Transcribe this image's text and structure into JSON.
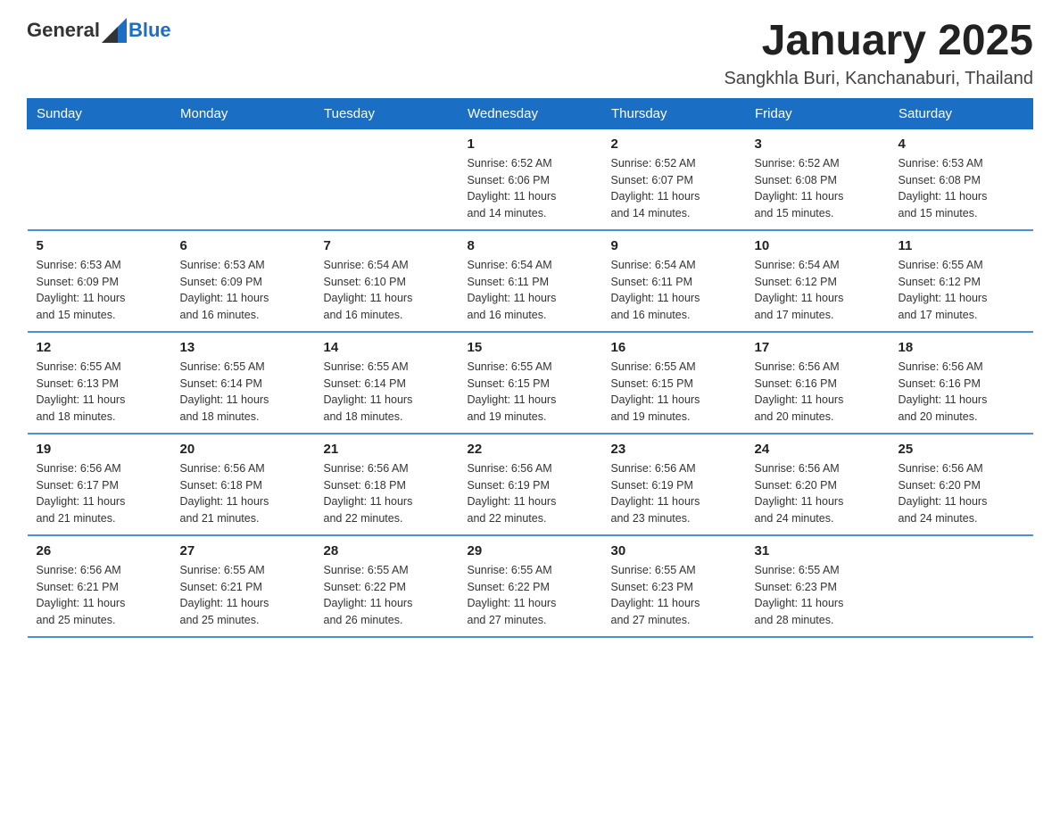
{
  "header": {
    "logo_general": "General",
    "logo_blue": "Blue",
    "title": "January 2025",
    "subtitle": "Sangkhla Buri, Kanchanaburi, Thailand"
  },
  "days_of_week": [
    "Sunday",
    "Monday",
    "Tuesday",
    "Wednesday",
    "Thursday",
    "Friday",
    "Saturday"
  ],
  "weeks": [
    [
      {
        "day": "",
        "info": ""
      },
      {
        "day": "",
        "info": ""
      },
      {
        "day": "",
        "info": ""
      },
      {
        "day": "1",
        "info": "Sunrise: 6:52 AM\nSunset: 6:06 PM\nDaylight: 11 hours\nand 14 minutes."
      },
      {
        "day": "2",
        "info": "Sunrise: 6:52 AM\nSunset: 6:07 PM\nDaylight: 11 hours\nand 14 minutes."
      },
      {
        "day": "3",
        "info": "Sunrise: 6:52 AM\nSunset: 6:08 PM\nDaylight: 11 hours\nand 15 minutes."
      },
      {
        "day": "4",
        "info": "Sunrise: 6:53 AM\nSunset: 6:08 PM\nDaylight: 11 hours\nand 15 minutes."
      }
    ],
    [
      {
        "day": "5",
        "info": "Sunrise: 6:53 AM\nSunset: 6:09 PM\nDaylight: 11 hours\nand 15 minutes."
      },
      {
        "day": "6",
        "info": "Sunrise: 6:53 AM\nSunset: 6:09 PM\nDaylight: 11 hours\nand 16 minutes."
      },
      {
        "day": "7",
        "info": "Sunrise: 6:54 AM\nSunset: 6:10 PM\nDaylight: 11 hours\nand 16 minutes."
      },
      {
        "day": "8",
        "info": "Sunrise: 6:54 AM\nSunset: 6:11 PM\nDaylight: 11 hours\nand 16 minutes."
      },
      {
        "day": "9",
        "info": "Sunrise: 6:54 AM\nSunset: 6:11 PM\nDaylight: 11 hours\nand 16 minutes."
      },
      {
        "day": "10",
        "info": "Sunrise: 6:54 AM\nSunset: 6:12 PM\nDaylight: 11 hours\nand 17 minutes."
      },
      {
        "day": "11",
        "info": "Sunrise: 6:55 AM\nSunset: 6:12 PM\nDaylight: 11 hours\nand 17 minutes."
      }
    ],
    [
      {
        "day": "12",
        "info": "Sunrise: 6:55 AM\nSunset: 6:13 PM\nDaylight: 11 hours\nand 18 minutes."
      },
      {
        "day": "13",
        "info": "Sunrise: 6:55 AM\nSunset: 6:14 PM\nDaylight: 11 hours\nand 18 minutes."
      },
      {
        "day": "14",
        "info": "Sunrise: 6:55 AM\nSunset: 6:14 PM\nDaylight: 11 hours\nand 18 minutes."
      },
      {
        "day": "15",
        "info": "Sunrise: 6:55 AM\nSunset: 6:15 PM\nDaylight: 11 hours\nand 19 minutes."
      },
      {
        "day": "16",
        "info": "Sunrise: 6:55 AM\nSunset: 6:15 PM\nDaylight: 11 hours\nand 19 minutes."
      },
      {
        "day": "17",
        "info": "Sunrise: 6:56 AM\nSunset: 6:16 PM\nDaylight: 11 hours\nand 20 minutes."
      },
      {
        "day": "18",
        "info": "Sunrise: 6:56 AM\nSunset: 6:16 PM\nDaylight: 11 hours\nand 20 minutes."
      }
    ],
    [
      {
        "day": "19",
        "info": "Sunrise: 6:56 AM\nSunset: 6:17 PM\nDaylight: 11 hours\nand 21 minutes."
      },
      {
        "day": "20",
        "info": "Sunrise: 6:56 AM\nSunset: 6:18 PM\nDaylight: 11 hours\nand 21 minutes."
      },
      {
        "day": "21",
        "info": "Sunrise: 6:56 AM\nSunset: 6:18 PM\nDaylight: 11 hours\nand 22 minutes."
      },
      {
        "day": "22",
        "info": "Sunrise: 6:56 AM\nSunset: 6:19 PM\nDaylight: 11 hours\nand 22 minutes."
      },
      {
        "day": "23",
        "info": "Sunrise: 6:56 AM\nSunset: 6:19 PM\nDaylight: 11 hours\nand 23 minutes."
      },
      {
        "day": "24",
        "info": "Sunrise: 6:56 AM\nSunset: 6:20 PM\nDaylight: 11 hours\nand 24 minutes."
      },
      {
        "day": "25",
        "info": "Sunrise: 6:56 AM\nSunset: 6:20 PM\nDaylight: 11 hours\nand 24 minutes."
      }
    ],
    [
      {
        "day": "26",
        "info": "Sunrise: 6:56 AM\nSunset: 6:21 PM\nDaylight: 11 hours\nand 25 minutes."
      },
      {
        "day": "27",
        "info": "Sunrise: 6:55 AM\nSunset: 6:21 PM\nDaylight: 11 hours\nand 25 minutes."
      },
      {
        "day": "28",
        "info": "Sunrise: 6:55 AM\nSunset: 6:22 PM\nDaylight: 11 hours\nand 26 minutes."
      },
      {
        "day": "29",
        "info": "Sunrise: 6:55 AM\nSunset: 6:22 PM\nDaylight: 11 hours\nand 27 minutes."
      },
      {
        "day": "30",
        "info": "Sunrise: 6:55 AM\nSunset: 6:23 PM\nDaylight: 11 hours\nand 27 minutes."
      },
      {
        "day": "31",
        "info": "Sunrise: 6:55 AM\nSunset: 6:23 PM\nDaylight: 11 hours\nand 28 minutes."
      },
      {
        "day": "",
        "info": ""
      }
    ]
  ]
}
